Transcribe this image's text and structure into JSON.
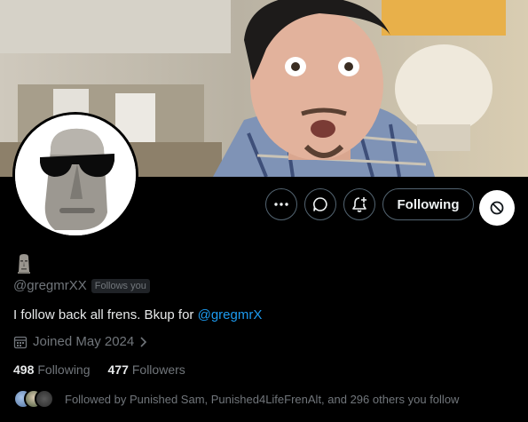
{
  "profile": {
    "handle": "@gregmrXX",
    "follows_you_badge": "Follows you",
    "bio_text": "I follow back all frens. Bkup for ",
    "bio_mention": "@gregmrX",
    "joined": "Joined May 2024",
    "following_count": "498",
    "following_label": "Following",
    "followers_count": "477",
    "followers_label": "Followers",
    "followed_by": "Followed by Punished Sam, Punished4LifeFrenAlt, and 296 others you follow"
  },
  "actions": {
    "more_icon": "more-icon",
    "message_icon": "message-icon",
    "notify_icon": "bell-plus-icon",
    "follow_label": "Following",
    "block_icon": "block-icon"
  },
  "colors": {
    "background": "#000000",
    "accent": "#1d9bf0",
    "muted": "#71767b",
    "text": "#e7e9ea",
    "border": "#536471"
  }
}
